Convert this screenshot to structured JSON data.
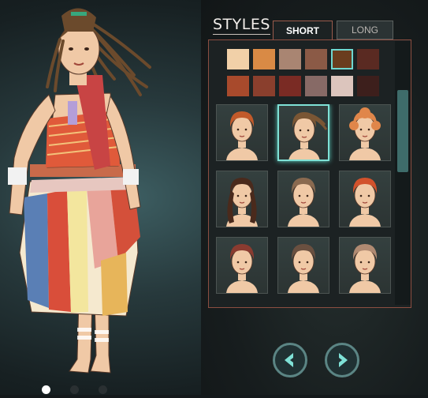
{
  "styles_panel": {
    "title": "STYLES",
    "tabs": [
      {
        "label": "SHORT",
        "active": true
      },
      {
        "label": "LONG",
        "active": false
      }
    ]
  },
  "hair_colors": [
    {
      "color": "#f1d0a8",
      "selected": false
    },
    {
      "color": "#d98a45",
      "selected": false
    },
    {
      "color": "#a98572",
      "selected": false
    },
    {
      "color": "#8b5a46",
      "selected": false
    },
    {
      "color": "#6a3d1e",
      "selected": true
    },
    {
      "color": "#5a2a22",
      "selected": false
    },
    {
      "color": "#a84a2c",
      "selected": false
    },
    {
      "color": "#8a3f2d",
      "selected": false
    },
    {
      "color": "#7a2b24",
      "selected": false
    },
    {
      "color": "#876a66",
      "selected": false
    },
    {
      "color": "#dcc5bd",
      "selected": false
    },
    {
      "color": "#3d1f1c",
      "selected": false
    }
  ],
  "hair_styles": [
    {
      "name": "short-spiky",
      "color": "#c25a2a",
      "selected": false
    },
    {
      "name": "dreadlocks-updo",
      "color": "#7a5634",
      "selected": true
    },
    {
      "name": "curly-bob",
      "color": "#e0864a",
      "selected": false
    },
    {
      "name": "long-wavy",
      "color": "#4a2a1c",
      "selected": false
    },
    {
      "name": "braided-pulled-back",
      "color": "#8a6a50",
      "selected": false
    },
    {
      "name": "swept-bob",
      "color": "#d2522c",
      "selected": false
    },
    {
      "name": "messy-short",
      "color": "#8a3b30",
      "selected": false
    },
    {
      "name": "top-knot",
      "color": "#6a5040",
      "selected": false
    },
    {
      "name": "braided-wrap",
      "color": "#b08a72",
      "selected": false
    }
  ],
  "colors": {
    "accent": "#7fe1d6",
    "panel_border": "#8c4e41",
    "skin": "#f0c9a6"
  },
  "page_dots": [
    {
      "active": true
    },
    {
      "active": false
    },
    {
      "active": false
    }
  ]
}
